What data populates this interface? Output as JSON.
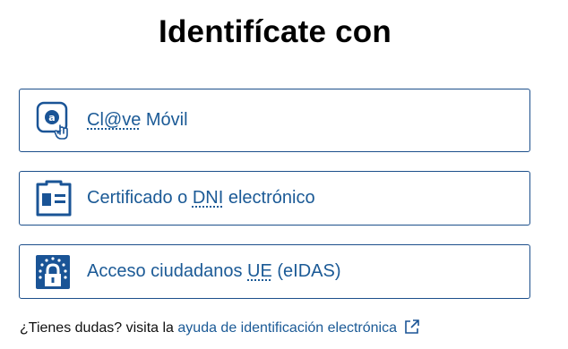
{
  "heading": "Identifícate con",
  "options": [
    {
      "icon": "clave-movil-icon",
      "label_pre": "",
      "label_abbr": "Cl@ve",
      "label_post": " Móvil"
    },
    {
      "icon": "id-card-icon",
      "label_pre": "Certificado o ",
      "label_abbr": "DNI",
      "label_post": " electrónico"
    },
    {
      "icon": "eu-padlock-icon",
      "label_pre": "Acceso ciudadanos ",
      "label_abbr": "UE",
      "label_post": " (eIDAS)"
    }
  ],
  "help": {
    "prefix": "¿Tienes dudas? visita la ",
    "link": "ayuda de identificación electrónica",
    "icon": "external-link-icon"
  },
  "colors": {
    "accent": "#1b5a96",
    "border": "#1c4f8b",
    "icon_blue": "#1a5496"
  }
}
